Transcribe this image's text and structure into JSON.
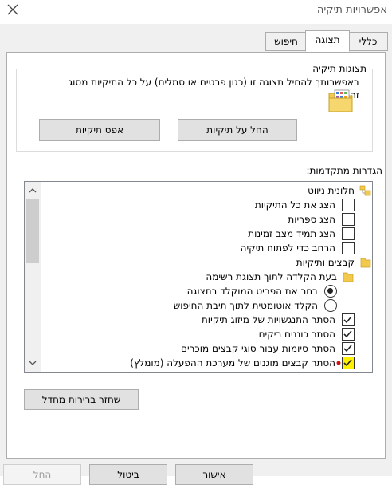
{
  "window": {
    "title": "אפשרויות תיקיה"
  },
  "tabs": [
    {
      "label": "כללי"
    },
    {
      "label": "תצוגה"
    },
    {
      "label": "חיפוש"
    }
  ],
  "folder_views": {
    "group_label": "תצוגות תיקיה",
    "description": "באפשרותך להחיל תצוגה זו (כגון פרטים או סמלים) על כל התיקיות מסוג זה.",
    "apply_button": "החל על תיקיות",
    "reset_button": "אפס תיקיות"
  },
  "advanced": {
    "label": "הגדרות מתקדמות:",
    "items": [
      {
        "text": "חלונית ניווט"
      },
      {
        "text": "הצג את כל התיקיות"
      },
      {
        "text": "הצג ספריות"
      },
      {
        "text": "הצג תמיד מצב זמינות"
      },
      {
        "text": "הרחב כדי לפתוח תיקיה"
      },
      {
        "text": "קבצים ותיקיות"
      },
      {
        "text": "בעת הקלדה לתוך תצוגת רשימה"
      },
      {
        "text": "בחר את הפריט המוקלד בתצוגה"
      },
      {
        "text": "הקלד אוטומטית לתוך תיבת החיפוש"
      },
      {
        "text": "הסתר התנגשויות של מיזוג תיקיות"
      },
      {
        "text": "הסתר כוננים ריקים"
      },
      {
        "text": "הסתר סיומות עבור סוגי קבצים מוכרים"
      },
      {
        "text": "הסתר קבצים מוגנים של מערכת ההפעלה (מומלץ)"
      }
    ],
    "restore_button": "שחזר ברירות מחדל"
  },
  "footer": {
    "ok": "אישור",
    "cancel": "ביטול",
    "apply": "החל"
  },
  "colors": {
    "folder": "#f2c94c",
    "highlight": "#ffef00",
    "checkbox_check": "#222222"
  }
}
